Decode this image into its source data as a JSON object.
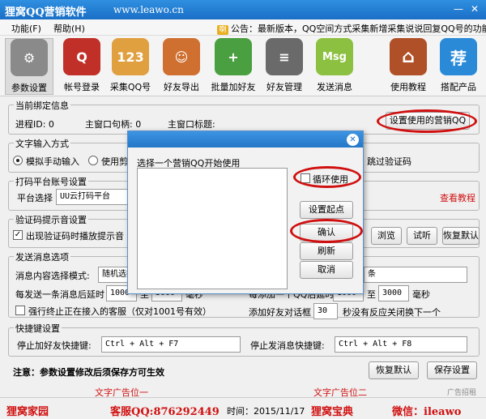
{
  "window": {
    "title": "狸窝QQ营销软件",
    "url": "www.leawo.cn",
    "minimize": "—",
    "close": "✕"
  },
  "menu": {
    "items": [
      "功能(F)",
      "帮助(H)"
    ],
    "notice": "公告：最新版本，QQ空间方式采集新增采集说说回复QQ号的功能！",
    "notice_icon": "喇"
  },
  "toolbar": {
    "items": [
      {
        "label": "参数设置",
        "glyph": "⚙",
        "color": "#8a8a8a"
      },
      {
        "label": "帐号登录",
        "glyph": "Q",
        "color": "#c03028"
      },
      {
        "label": "采集QQ号",
        "glyph": "123",
        "color": "#e0a040"
      },
      {
        "label": "好友导出",
        "glyph": "☺",
        "color": "#d07030"
      },
      {
        "label": "批量加好友",
        "glyph": "+",
        "color": "#4aa040"
      },
      {
        "label": "好友管理",
        "glyph": "≡",
        "color": "#6a6a6a"
      },
      {
        "label": "发送消息",
        "glyph": "Msg",
        "color": "#8cc040"
      },
      {
        "label": "使用教程",
        "glyph": "⌂",
        "color": "#b05028"
      },
      {
        "label": "搭配产品",
        "glyph": "荐",
        "color": "#2a8ad8"
      }
    ]
  },
  "binding": {
    "title": "当前绑定信息",
    "process": "进程ID: 0",
    "handle": "主窗口句柄: 0",
    "window_title": "主窗口标题:",
    "set_button": "设置使用的营销QQ"
  },
  "text_input": {
    "title": "文字输入方式",
    "opt1": "模拟手动输入",
    "opt2": "使用剪贴板",
    "skip": "跳过验证码"
  },
  "platform": {
    "title": "打码平台账号设置",
    "label": "平台选择",
    "value": "UU云打码平台",
    "tutorial": "查看教程"
  },
  "captcha": {
    "title": "验证码提示音设置",
    "check": "出现验证码时播放提示音",
    "browse": "浏览",
    "test": "试听",
    "restore": "恢复默认"
  },
  "send": {
    "title": "发送消息选项",
    "mode_label": "消息内容选择模式:",
    "mode_value": "随机选择",
    "mode_right": "条",
    "delay_label": "每发送一条消息后延时",
    "delay_from": "1000",
    "to": "至",
    "delay_to": "3000",
    "unit": "毫秒",
    "force_stop": "强行终止正在接入的客服（仅对1001号有效）",
    "add_delay_label": "每添加一个QQ后延时",
    "add_from": "1000",
    "add_to": "3000",
    "add_unit": "毫秒",
    "dialog_label": "添加好友对话框",
    "dialog_value": "30",
    "dialog_suffix": "秒没有反应关闭换下一个"
  },
  "hotkeys": {
    "title": "快捷键设置",
    "stop_add_label": "停止加好友快捷键:",
    "stop_add_value": "Ctrl + Alt + F7",
    "stop_send_label": "停止发消息快捷键:",
    "stop_send_value": "Ctrl + Alt + F8"
  },
  "footer": {
    "note": "注意：参数设置修改后须保存方可生效",
    "restore": "恢复默认",
    "save": "保存设置",
    "ad1": "文字广告位一",
    "ad2": "文字广告位二",
    "ad_link": "广告招租"
  },
  "status": {
    "home": "狸窝家园",
    "service": "客服QQ:876292449",
    "time": "时间：2015/11/17",
    "guide": "狸窝宝典",
    "wechat": "微信：ileawo"
  },
  "dialog": {
    "prompt": "选择一个营销QQ开始使用",
    "loop": "循环使用",
    "set_start": "设置起点",
    "confirm": "确认",
    "refresh": "刷新",
    "cancel": "取消",
    "close": "✕"
  },
  "colors": {
    "accent": "#1a6fc6",
    "highlight": "#d01010"
  }
}
